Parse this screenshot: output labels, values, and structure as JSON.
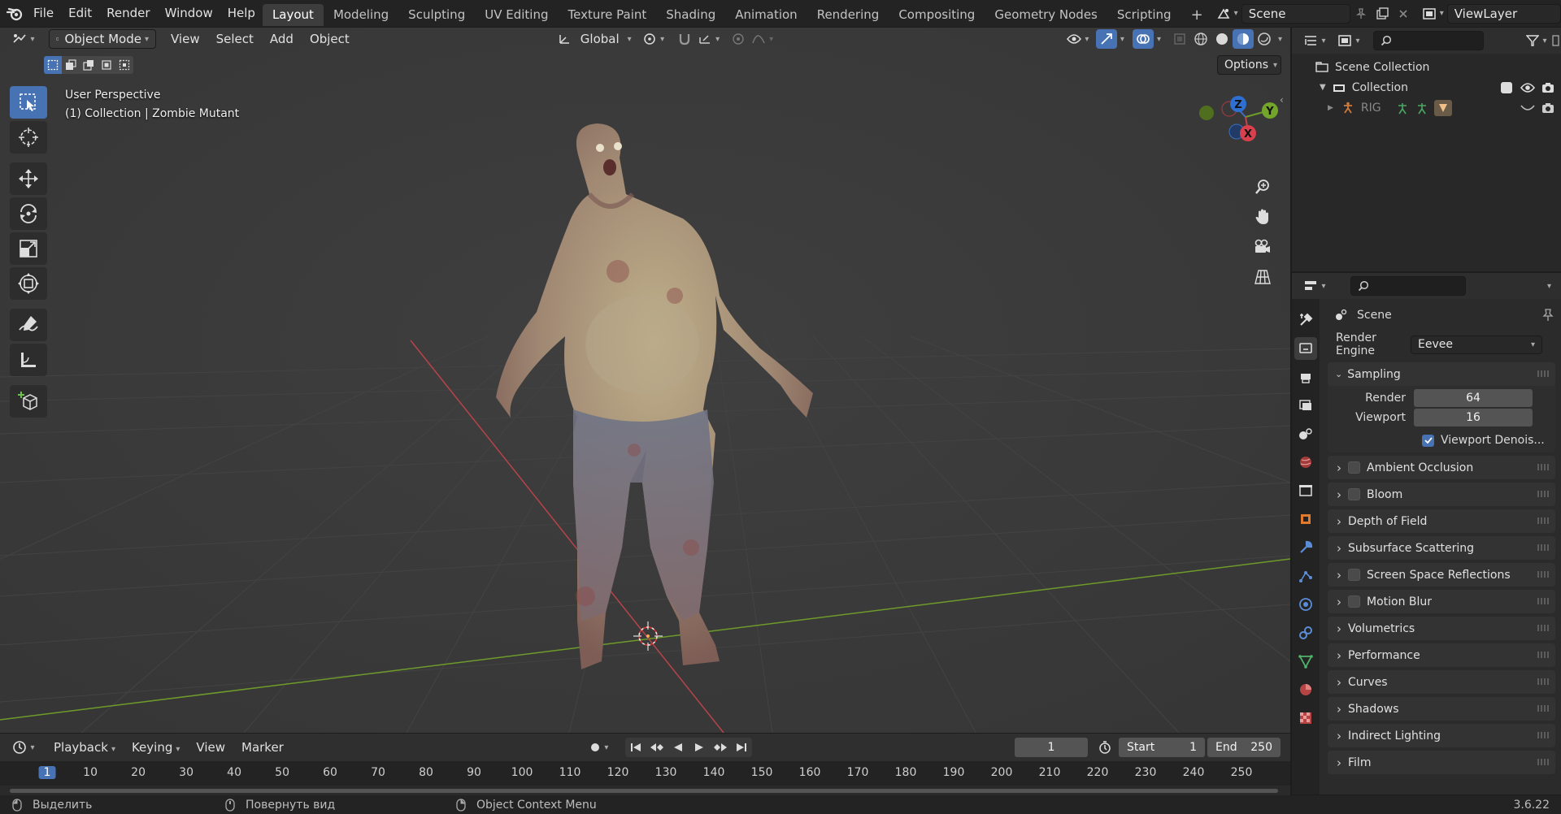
{
  "topbar": {
    "menus": [
      "File",
      "Edit",
      "Render",
      "Window",
      "Help"
    ],
    "workspaces": [
      "Layout",
      "Modeling",
      "Sculpting",
      "UV Editing",
      "Texture Paint",
      "Shading",
      "Animation",
      "Rendering",
      "Compositing",
      "Geometry Nodes",
      "Scripting"
    ],
    "active_workspace": "Layout",
    "add_tab": "+",
    "scene": "Scene",
    "view_layer": "ViewLayer"
  },
  "viewport": {
    "mode": "Object Mode",
    "menus": [
      "View",
      "Select",
      "Add",
      "Object"
    ],
    "transform_orientation": "Global",
    "options_label": "Options",
    "info_line1": "User Perspective",
    "info_line2": "(1) Collection | Zombie Mutant",
    "gizmo": {
      "x": "X",
      "y": "Y",
      "z": "Z"
    }
  },
  "outliner": {
    "scene_collection": "Scene Collection",
    "collection": "Collection",
    "rig": "RIG"
  },
  "properties": {
    "title": "Scene",
    "render_engine_label": "Render Engine",
    "render_engine": "Eevee",
    "sampling": {
      "label": "Sampling",
      "render_label": "Render",
      "render_value": "64",
      "viewport_label": "Viewport",
      "viewport_value": "16",
      "denoise_label": "Viewport Denois..."
    },
    "panels": [
      {
        "label": "Ambient Occlusion",
        "checkbox": true
      },
      {
        "label": "Bloom",
        "checkbox": true
      },
      {
        "label": "Depth of Field",
        "checkbox": false
      },
      {
        "label": "Subsurface Scattering",
        "checkbox": false
      },
      {
        "label": "Screen Space Reflections",
        "checkbox": true
      },
      {
        "label": "Motion Blur",
        "checkbox": true
      },
      {
        "label": "Volumetrics",
        "checkbox": false
      },
      {
        "label": "Performance",
        "checkbox": false
      },
      {
        "label": "Curves",
        "checkbox": false
      },
      {
        "label": "Shadows",
        "checkbox": false
      },
      {
        "label": "Indirect Lighting",
        "checkbox": false
      },
      {
        "label": "Film",
        "checkbox": false
      }
    ]
  },
  "timeline": {
    "menus": [
      "Playback",
      "Keying",
      "View",
      "Marker"
    ],
    "current_frame": "1",
    "start_label": "Start",
    "start": "1",
    "end_label": "End",
    "end": "250",
    "ruler": [
      "1",
      "10",
      "20",
      "30",
      "40",
      "50",
      "60",
      "70",
      "80",
      "90",
      "100",
      "110",
      "120",
      "130",
      "140",
      "150",
      "160",
      "170",
      "180",
      "190",
      "200",
      "210",
      "220",
      "230",
      "240",
      "250"
    ]
  },
  "statusbar": {
    "select": "Выделить",
    "rotate": "Повернуть вид",
    "context": "Object Context Menu",
    "version": "3.6.22"
  },
  "colors": {
    "accent": "#4772b3",
    "x_axis": "#c8414b",
    "y_axis": "#6e9b2a",
    "z_axis": "#2f6fd1"
  }
}
